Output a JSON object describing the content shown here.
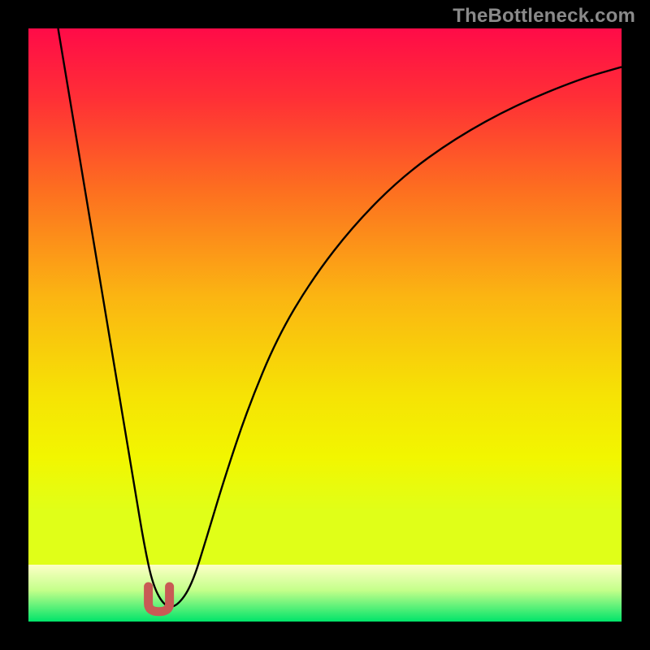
{
  "watermark": "TheBottleneck.com",
  "chart_data": {
    "type": "line",
    "title": "",
    "xlabel": "",
    "ylabel": "",
    "xlim": [
      0,
      100
    ],
    "ylim": [
      0,
      100
    ],
    "grid": false,
    "legend": false,
    "background_gradient": {
      "direction": "vertical",
      "stops_main": [
        {
          "t": 0.0,
          "color": "#ff0b48"
        },
        {
          "t": 0.13,
          "color": "#ff2f36"
        },
        {
          "t": 0.3,
          "color": "#fd6e20"
        },
        {
          "t": 0.5,
          "color": "#fbb512"
        },
        {
          "t": 0.68,
          "color": "#f6e205"
        },
        {
          "t": 0.8,
          "color": "#f2f600"
        },
        {
          "t": 0.9,
          "color": "#e0ff18"
        }
      ],
      "stops_tail": [
        {
          "t": 0.0,
          "color": "#fdffc6"
        },
        {
          "t": 0.45,
          "color": "#c4ff8a"
        },
        {
          "t": 1.0,
          "color": "#00e46a"
        }
      ]
    },
    "series": [
      {
        "name": "bottleneck-curve",
        "color": "#000000",
        "width": 2.4,
        "x": [
          5,
          6.5,
          8,
          10,
          12,
          14,
          16,
          18,
          19.5,
          21,
          23,
          25,
          27.5,
          30,
          33,
          37,
          42,
          48,
          55,
          63,
          72,
          82,
          93,
          100
        ],
        "values": [
          100,
          91,
          82,
          70,
          58,
          46,
          34,
          22,
          13,
          6,
          2.5,
          2.5,
          6,
          14,
          24,
          36,
          48,
          58,
          67,
          75,
          81.5,
          87,
          91.5,
          93.5
        ]
      }
    ],
    "marker": {
      "name": "optimal-point",
      "shape": "U",
      "color": "#c85a55",
      "x": 22,
      "y": 2.5,
      "size": 26
    }
  }
}
